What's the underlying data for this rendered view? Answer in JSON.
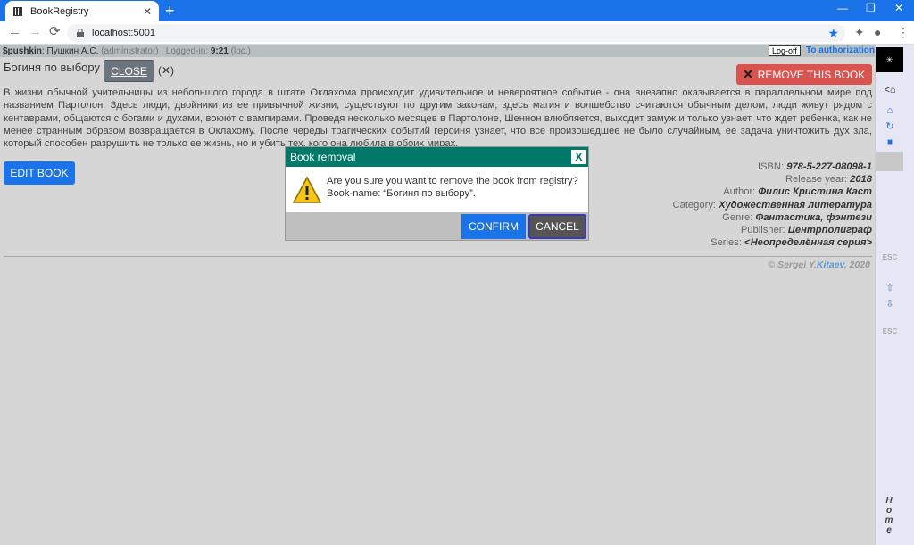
{
  "browser": {
    "tab_title": "BookRegistry",
    "tab_close": "✕",
    "new_tab": "+",
    "url": "localhost:5001",
    "controls": {
      "minimize": "—",
      "restore": "❐",
      "close": "✕"
    }
  },
  "userbar": {
    "login": "$pushkin",
    "name": ": Пушкин А.С.",
    "role": "(administrator)",
    "logged_in_label": "| Logged-in:",
    "time": "9:21",
    "loc": "(loc.)",
    "logoff_label": "Log-off",
    "auth_link": "To authorization"
  },
  "book": {
    "title": "Богиня по выбору",
    "close_label": "CLOSE",
    "close_x": "(✕)",
    "remove_label": "REMOVE THIS BOOK",
    "annotation": "В жизни обычной учительницы из небольшого города в штате Оклахома происходит удивительное и невероятное событие - она внезапно оказывается в параллельном мире под названием Партолон. Здесь люди, двойники из ее привычной жизни, существуют по другим законам, здесь магия и волшебство считаются обычным делом, люди живут рядом с кентаврами, общаются с богами и духами, воюют с вампирами. Проведя несколько месяцев в Партолоне, Шеннон влюбляется, выходит замуж и только узнает, что ждет ребенка, как не менее странным образом возвращается в Оклахому. После череды трагических событий героиня узнает, что все произошедшее не было случайным, ее задача уничтожить дух зла, который способен разрушить не только ее жизнь, но и убить тех, кого она любила в обоих мирах.",
    "edit_label": "EDIT BOOK",
    "details": [
      {
        "label": "ISBN:",
        "value": "978-5-227-08098-1"
      },
      {
        "label": "Release year:",
        "value": "2018"
      },
      {
        "label": "Author:",
        "value": "Филис Кристина Каст"
      },
      {
        "label": "Category:",
        "value": "Художественная литература"
      },
      {
        "label": "Genre:",
        "value": "Фантастика, фэнтези"
      },
      {
        "label": "Publisher:",
        "value": "Центрполиграф"
      },
      {
        "label": "Series:",
        "value": "<Неопределённая серия>"
      }
    ],
    "copyright_prefix": "© Sergei Y.",
    "copyright_name": "Kitaev",
    "copyright_suffix": ", 2020"
  },
  "side": {
    "top": "✳",
    "esc1": "ESC",
    "esc2": "ESC",
    "home": "Home"
  },
  "modal": {
    "title": "Book removal",
    "x_label": "X",
    "line1": "Are you sure you want to remove the book from registry?",
    "line2": "Book-name: “Богиня по выбору”.",
    "confirm_label": "CONFIRM",
    "cancel_label": "CANCEL"
  }
}
